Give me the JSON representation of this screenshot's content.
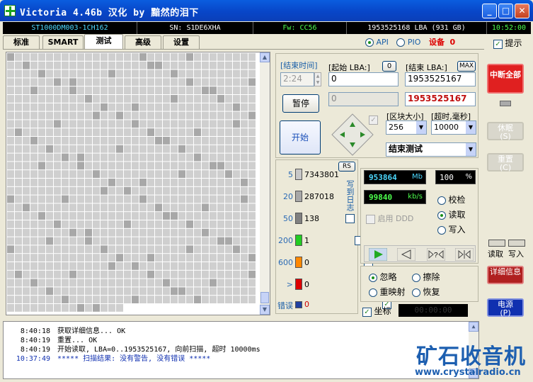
{
  "window": {
    "title": "Victoria 4.46b 汉化 by 黯然的泪下",
    "min": "_",
    "max": "□",
    "close": "✕"
  },
  "info": {
    "model": "ST1000DM003-1CH162",
    "serial": "SN: S1DE6XHA",
    "firmware": "Fw: CC56",
    "capacity": "1953525168 LBA (931 GB)",
    "clock": "10:52:00"
  },
  "tabs": [
    "标准",
    "SMART",
    "测试",
    "高级",
    "设置"
  ],
  "mode": {
    "api": "API",
    "pio": "PIO",
    "device_label": "设备",
    "device_num": "0",
    "hint": "提示"
  },
  "test": {
    "end_time_label": "[结束时间]",
    "end_time": "2:24",
    "start_lba_label": "[起始 LBA:]",
    "start_lba_btn": "0",
    "start_lba": "0",
    "end_lba_label": "[结束 LBA:]",
    "max_btn": "MAX",
    "end_lba": "1953525167",
    "cur_lba": "0",
    "end_lba_red": "1953525167",
    "pause": "暂停",
    "start": "开始",
    "block_label": "[区块大小]",
    "block": "256",
    "timeout_label": "[超时,毫秒]",
    "timeout": "10000",
    "action": "结束测试"
  },
  "stats": {
    "rs": "RS",
    "rows": [
      {
        "ms": "5",
        "count": "7343801",
        "color": "#c8c8c8"
      },
      {
        "ms": "20",
        "count": "287018",
        "color": "#a8a8a8"
      },
      {
        "ms": "50",
        "count": "138",
        "color": "#808080"
      },
      {
        "ms": "200",
        "count": "1",
        "color": "#22cc22"
      },
      {
        "ms": "600",
        "count": "0",
        "color": "#ff8800"
      },
      {
        "ms": ">",
        "count": "0",
        "color": "#dd0000"
      },
      {
        "ms": "错误",
        "count": "0",
        "color": "#2040a0"
      }
    ],
    "log_to_file": "写到日志"
  },
  "progress": {
    "mb": "953864",
    "mb_unit": "Mb",
    "pct": "100",
    "pct_unit": "%",
    "speed": "99840",
    "speed_unit": "kb/s",
    "ddd": "启用 DDD",
    "verify": "校检",
    "read": "读取",
    "write": "写入"
  },
  "error_action": {
    "ignore": "忽略",
    "erase": "擦除",
    "remap": "重映射",
    "restore": "恢复"
  },
  "coord": {
    "label": "坐标",
    "value": "00:00:00"
  },
  "right": {
    "stop_all": "中断全部",
    "sleep": "休眠\n(S)",
    "reset": "重置\n(C)",
    "read_led": "读取",
    "write_led": "写入",
    "detail": "详细信息",
    "power": "电源\n(P)"
  },
  "log": [
    {
      "time": "8:40:18",
      "msg": "获取详细信息... OK"
    },
    {
      "time": "8:40:19",
      "msg": "重置... OK"
    },
    {
      "time": "8:40:19",
      "msg": "开始读取, LBA=0..1953525167, 向前扫描, 超时 10000ms"
    },
    {
      "time": "10:37:49",
      "msg": "***** 扫描结果: 没有警告, 没有错误 *****"
    }
  ],
  "watermark": {
    "text": "矿石收音机",
    "url": "www.crystalradio.cn"
  }
}
